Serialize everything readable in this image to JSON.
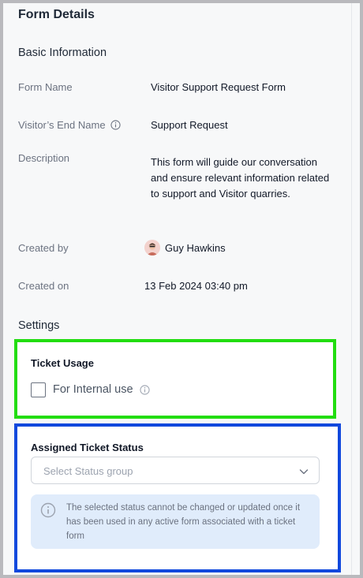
{
  "page": {
    "title": "Form Details",
    "basic_heading": "Basic Information",
    "settings_heading": "Settings"
  },
  "fields": {
    "form_name": {
      "label": "Form Name",
      "value": "Visitor Support Request Form"
    },
    "end_name": {
      "label": "Visitor’s End Name",
      "value": "Support Request",
      "icon": "info-icon"
    },
    "description": {
      "label": "Description",
      "value": "This form will guide our conversation and ensure relevant information related to support and Visitor quarries."
    },
    "created_by": {
      "label": "Created by",
      "value": "Guy Hawkins",
      "icon": "avatar"
    },
    "created_on": {
      "label": "Created on",
      "value": "13 Feb 2024 03:40 pm"
    }
  },
  "ticket_usage": {
    "title": "Ticket Usage",
    "checkbox_label": "For Internal use",
    "checked": false,
    "highlight_color": "#22dd11"
  },
  "assigned_status": {
    "title": "Assigned Ticket Status",
    "select_placeholder": "Select Status group",
    "note": "The selected status cannot be changed or updated once it has been used in any active form associated with a ticket form",
    "highlight_color": "#1048dd",
    "note_background": "#e0ecfb"
  }
}
